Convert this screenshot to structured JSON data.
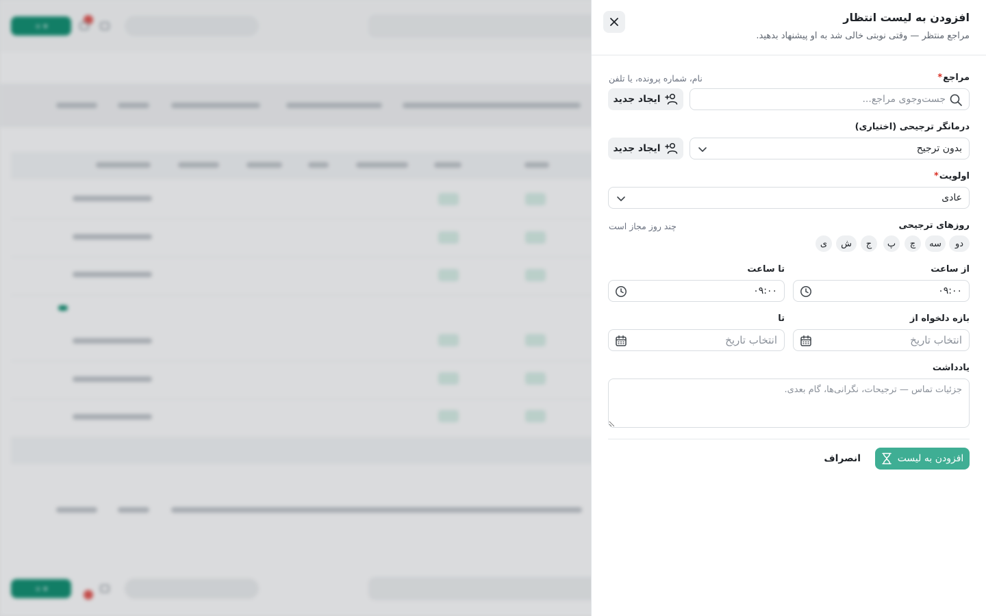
{
  "drawer": {
    "title": "افزودن به لیست انتظار",
    "subtitle": "مراجع منتظر — وقتی نوبتی خالی شد به او پیشنهاد بدهید."
  },
  "form": {
    "client": {
      "label": "مراجع",
      "required_mark": "*",
      "hint": "نام، شماره پرونده، یا تلفن",
      "placeholder": "جست‌وجوی مراجع...",
      "create_label": "ایجاد جدید"
    },
    "therapist": {
      "label": "درمانگر ترجیحی (اختیاری)",
      "value": "بدون ترجیح",
      "create_label": "ایجاد جدید"
    },
    "priority": {
      "label": "اولویت",
      "required_mark": "*",
      "value": "عادی"
    },
    "days": {
      "label": "روزهای ترجیحی",
      "hint": "چند روز مجاز است",
      "options": [
        "دو",
        "سه",
        "چ",
        "پ",
        "ج",
        "ش",
        "ی"
      ]
    },
    "from_time": {
      "label": "از ساعت",
      "value": "۰۹:۰۰"
    },
    "to_time": {
      "label": "تا ساعت",
      "value": "۰۹:۰۰"
    },
    "from_date": {
      "label": "بازه دلخواه از",
      "placeholder": "انتخاب تاریخ"
    },
    "to_date": {
      "label": "تا",
      "placeholder": "انتخاب تاریخ"
    },
    "note": {
      "label": "یادداشت",
      "placeholder": "جزئیات تماس — ترجیحات، نگرانی‌ها، گام بعدی."
    }
  },
  "actions": {
    "submit_label": "افزودن به لیست",
    "cancel_label": "انصراف"
  },
  "colors": {
    "primary": "#3fae94",
    "required": "#d93025",
    "background_accent": "#0f8a6e"
  }
}
